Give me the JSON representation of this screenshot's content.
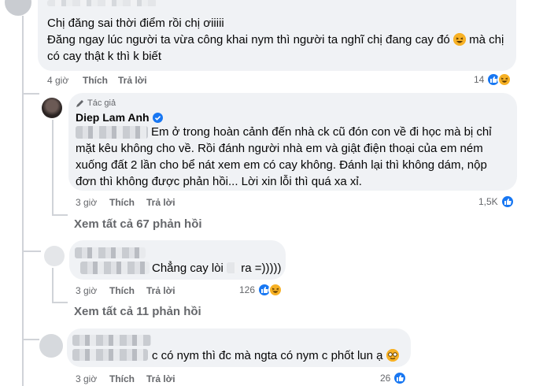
{
  "comment1": {
    "line1": "Chị đăng sai thời điểm rồi chị ơiiiii",
    "line2": "Đăng ngay lúc người ta vừa công khai nym thì người ta nghĩ chị đang cay đó",
    "line2_tail": "mà chị",
    "line3": "có cay thật k thì k biết",
    "time": "4 giờ",
    "like_label": "Thích",
    "reply_label": "Trả lời",
    "reaction_count": "14"
  },
  "reply1": {
    "badge": "Tác giả",
    "author": "Diep Lam Anh",
    "text1": "Em ở trong hoàn cảnh đến nhà ck cũ đón con về đi học mà bị chỉ",
    "text2": "mặt kêu không cho về. Rồi đánh người nhà em và giật điện thoại của em ném",
    "text3": "xuống đất 2 lần cho bể nát xem em có cay không. Đánh lại thì không dám, nộp",
    "text4": "đơn thì không được phản hồi... Lời xin lỗi thì quá xa xỉ.",
    "time": "3 giờ",
    "like_label": "Thích",
    "reply_label": "Trả lời",
    "reaction_count": "1,5K"
  },
  "view_more_1": "Xem tất cả 67 phản hồi",
  "comment2": {
    "text_a": "Chẳng cay lòi",
    "text_b": "ra =)))))",
    "time": "3 giờ",
    "like_label": "Thích",
    "reply_label": "Trả lời",
    "reaction_count": "126"
  },
  "view_more_2": "Xem tất cả 11 phản hồi",
  "comment3": {
    "text": "c có nym thì đc mà ngta có nym c phốt lun ạ",
    "time": "3 giờ",
    "like_label": "Thích",
    "reply_label": "Trả lời",
    "reaction_count": "26"
  },
  "icons": {
    "like": "like-icon",
    "haha": "haha-icon",
    "verified": "verified-badge-icon",
    "pencil": "pencil-icon"
  },
  "colors": {
    "accent": "#1877f2",
    "bubble": "#f0f2f5",
    "muted": "#65676b"
  }
}
